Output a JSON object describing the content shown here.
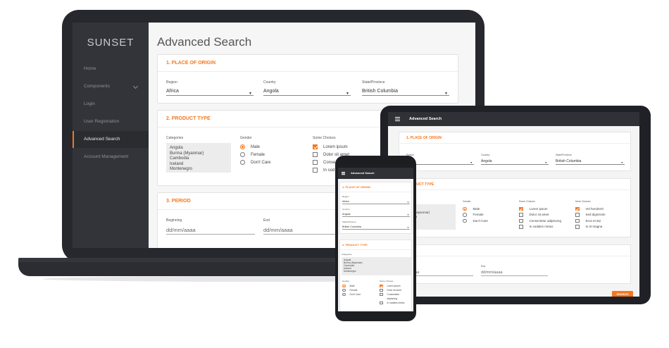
{
  "app": {
    "brand": "SUNSET",
    "page_title": "Advanced Search"
  },
  "colors": {
    "accent": "#f5781e",
    "sidebar": "#323439",
    "topbar": "#2f3136",
    "device": "#26282d"
  },
  "sidebar": {
    "items": [
      {
        "label": "Home"
      },
      {
        "label": "Components",
        "icon": "chevron-down-icon"
      },
      {
        "label": "Login"
      },
      {
        "label": "User Registration"
      },
      {
        "label": "Advanced Search",
        "active": true
      },
      {
        "label": "Account Management"
      }
    ]
  },
  "sections": {
    "origin": {
      "title": "1. PLACE OF ORIGIN",
      "region": {
        "label": "Region",
        "value": "Africa"
      },
      "country": {
        "label": "Country",
        "value": "Angola"
      },
      "state": {
        "label": "State/Province",
        "value": "British Columbia"
      }
    },
    "product": {
      "title": "2. PRODUCT TYPE",
      "categories": {
        "label": "Categories",
        "options": [
          "Angola",
          "Burma (Myanmar)",
          "Cambodia",
          "Iceland",
          "Montenegro"
        ]
      },
      "gender": {
        "label": "Gender",
        "options": [
          "Male",
          "Female",
          "Don't Care"
        ],
        "selected": "Male"
      },
      "some_choices": {
        "label": "Some Choices",
        "options": [
          "Lorem ipsum",
          "Dolor sit amet",
          "Consectetur adipiscing",
          "In sodales metus"
        ],
        "checked": [
          "Lorem ipsum"
        ]
      },
      "more_choices": {
        "label": "More Choices",
        "options": [
          "Vel hendrerit",
          "Sed dignissim",
          "Eros et dui",
          "In et magna"
        ],
        "checked": [
          "Vel hendrerit"
        ]
      }
    },
    "period": {
      "title": "3. PERIOD",
      "beginning": {
        "label": "Beginning",
        "placeholder": "dd/mm/aaaa"
      },
      "end": {
        "label": "End",
        "placeholder": "dd/mm/aaaa"
      }
    }
  },
  "laptop_view": {
    "origin_title": "1. PLACE OF ORIGIN",
    "product_title": "2. PRODUCT TYPE",
    "period_title": "3. PERIOD",
    "some_choices_visible": [
      "Lorem ipsum",
      "Dolor sit amet",
      "Conse",
      "In sod"
    ]
  },
  "tablet_view": {
    "region_value": "ca",
    "product_title": "PRODUCT TYPE",
    "categories_visible": [
      "ola",
      "ma (Myanmar)",
      "bodia",
      "and"
    ],
    "period_title": "RIOD",
    "beginning_label": "ning",
    "beginning_placeholder": "m/aaaa",
    "search_button": "SEARCH"
  },
  "phone_view": {
    "categories_visible": [
      "Angola",
      "Burma (Myanmar)",
      "Cambodia",
      "Iceland",
      "Montenegro"
    ],
    "some_choices_visible": [
      "Lorem ipsum",
      "Dolor sit amet",
      "Consectetur",
      "adipiscing",
      "In sodales metus"
    ]
  }
}
